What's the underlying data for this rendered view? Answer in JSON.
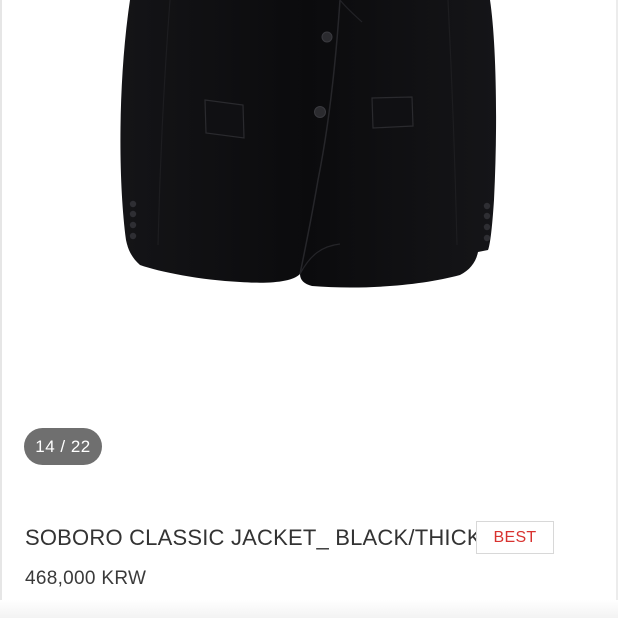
{
  "gallery": {
    "image_alt": "SOBORO CLASSIC JACKET_ BLACK/THICK",
    "counter": {
      "current": "14",
      "separator": " / ",
      "total": "22"
    }
  },
  "product": {
    "title": "SOBORO CLASSIC JACKET_ BLACK/THICK",
    "badge": "BEST",
    "price": "468,000 KRW"
  },
  "colors": {
    "jacket": "#0d0d0f",
    "counter_bg": "#6f6f6f",
    "badge_text": "#d8322f",
    "title_text": "#333333"
  }
}
